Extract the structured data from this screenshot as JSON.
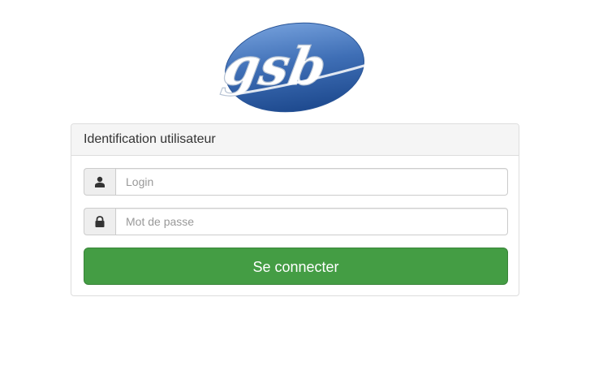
{
  "logo": {
    "text": "gsb",
    "brand_color": "#3f6fb6"
  },
  "panel": {
    "heading": "Identification utilisateur"
  },
  "form": {
    "login": {
      "icon": "user-icon",
      "placeholder": "Login",
      "value": ""
    },
    "password": {
      "icon": "lock-icon",
      "placeholder": "Mot de passe",
      "value": ""
    },
    "submit_label": "Se connecter",
    "submit_color": "#449d44"
  }
}
